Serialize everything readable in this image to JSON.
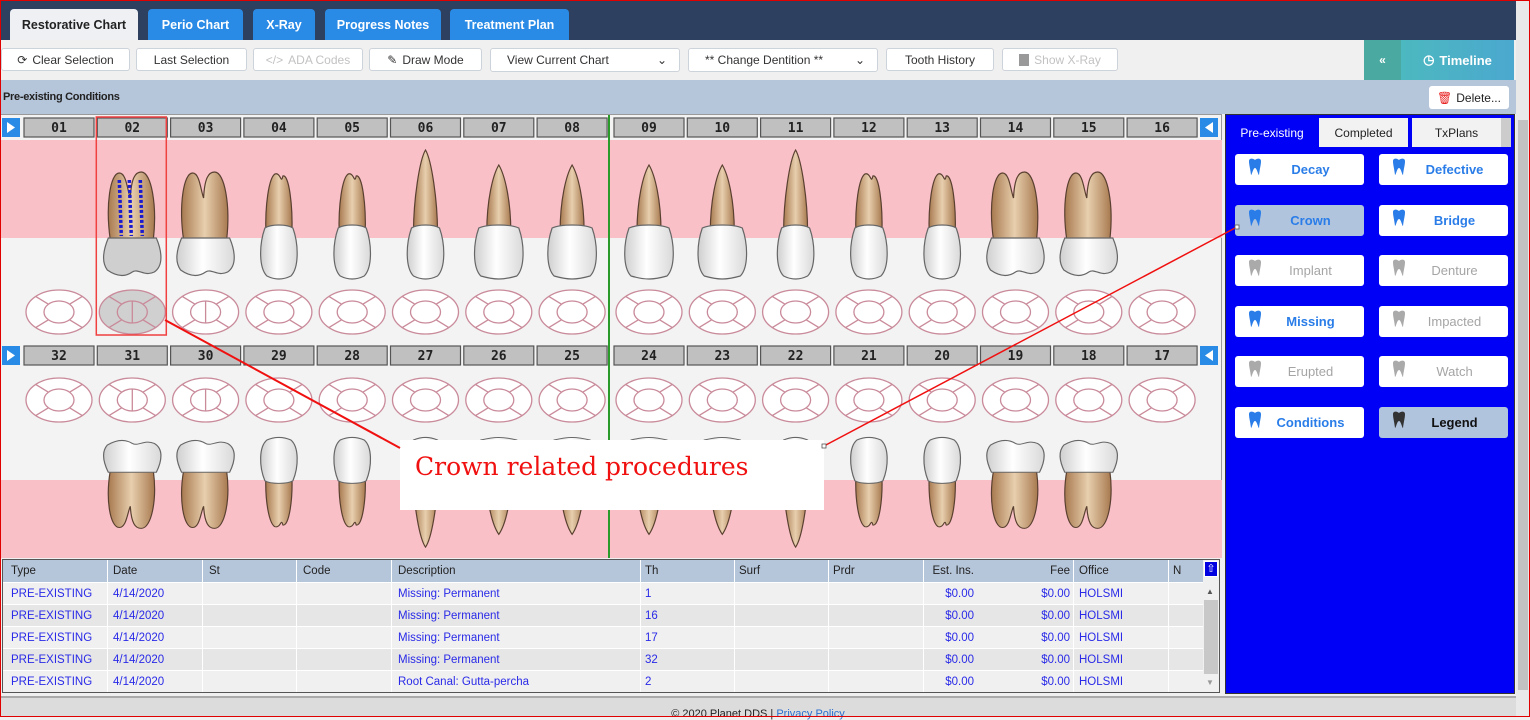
{
  "tabs": [
    {
      "label": "Restorative Chart",
      "active": true
    },
    {
      "label": "Perio Chart"
    },
    {
      "label": "X-Ray"
    },
    {
      "label": "Progress Notes"
    },
    {
      "label": "Treatment Plan"
    }
  ],
  "toolbar": {
    "clear_selection": "Clear Selection",
    "last_selection": "Last Selection",
    "ada_codes": "ADA Codes",
    "draw_mode": "Draw Mode",
    "view_select": "View Current Chart",
    "dentition_select": "** Change Dentition **",
    "tooth_history": "Tooth History",
    "show_xray": "Show X-Ray",
    "timeline": "Timeline"
  },
  "condition_bar": {
    "title": "Pre-existing Conditions",
    "delete": "Delete..."
  },
  "chart": {
    "upper_teeth": [
      "01",
      "02",
      "03",
      "04",
      "05",
      "06",
      "07",
      "08",
      "09",
      "10",
      "11",
      "12",
      "13",
      "14",
      "15",
      "16"
    ],
    "lower_teeth": [
      "32",
      "31",
      "30",
      "29",
      "28",
      "27",
      "26",
      "25",
      "24",
      "23",
      "22",
      "21",
      "20",
      "19",
      "18",
      "17"
    ],
    "missing": [
      1,
      16,
      17,
      32
    ],
    "root_canal": [
      2
    ],
    "selected_tooth": 2,
    "colors": {
      "gum": "#f9c0c8",
      "root": "#c49a6c",
      "occlusal": "#c98a9a",
      "selection": "#f04040",
      "midline": "#2a9a2a"
    }
  },
  "annotation": {
    "text": "Crown related procedures",
    "color": "#f01010"
  },
  "panel": {
    "tabs": [
      {
        "label": "Pre-existing",
        "active": true
      },
      {
        "label": "Completed"
      },
      {
        "label": "TxPlans"
      }
    ],
    "buttons": [
      {
        "label": "Decay",
        "icon": "tooth-icon",
        "state": "enabled"
      },
      {
        "label": "Defective",
        "icon": "tooth-icon",
        "state": "enabled"
      },
      {
        "label": "Crown",
        "icon": "crown-tooth-icon",
        "state": "selected"
      },
      {
        "label": "Bridge",
        "icon": "bridge-icon",
        "state": "enabled"
      },
      {
        "label": "Implant",
        "icon": "implant-icon",
        "state": "disabled"
      },
      {
        "label": "Denture",
        "icon": "denture-icon",
        "state": "disabled"
      },
      {
        "label": "Missing",
        "icon": "missing-tooth-icon",
        "state": "enabled"
      },
      {
        "label": "Impacted",
        "icon": "impacted-tooth-icon",
        "state": "disabled"
      },
      {
        "label": "Erupted",
        "icon": "erupted-tooth-icon",
        "state": "disabled"
      },
      {
        "label": "Watch",
        "icon": "watch-tooth-icon",
        "state": "disabled"
      },
      {
        "label": "Conditions",
        "icon": "conditions-icon",
        "state": "enabled"
      },
      {
        "label": "Legend",
        "icon": "legend-tooth-icon",
        "state": "selected"
      }
    ]
  },
  "table": {
    "columns": [
      "Type",
      "Date",
      "St",
      "Code",
      "Description",
      "Th",
      "Surf",
      "Prdr",
      "Est. Ins.",
      "Fee",
      "Office",
      "N"
    ],
    "rows": [
      [
        "PRE-EXISTING",
        "4/14/2020",
        "",
        "",
        "Missing: Permanent",
        "1",
        "",
        "",
        "$0.00",
        "$0.00",
        "HOLSMI",
        ""
      ],
      [
        "PRE-EXISTING",
        "4/14/2020",
        "",
        "",
        "Missing: Permanent",
        "16",
        "",
        "",
        "$0.00",
        "$0.00",
        "HOLSMI",
        ""
      ],
      [
        "PRE-EXISTING",
        "4/14/2020",
        "",
        "",
        "Missing: Permanent",
        "17",
        "",
        "",
        "$0.00",
        "$0.00",
        "HOLSMI",
        ""
      ],
      [
        "PRE-EXISTING",
        "4/14/2020",
        "",
        "",
        "Missing: Permanent",
        "32",
        "",
        "",
        "$0.00",
        "$0.00",
        "HOLSMI",
        ""
      ],
      [
        "PRE-EXISTING",
        "4/14/2020",
        "",
        "",
        "Root Canal:  Gutta-percha",
        "2",
        "",
        "",
        "$0.00",
        "$0.00",
        "HOLSMI",
        ""
      ]
    ]
  },
  "footer": {
    "copyright": "© 2020 Planet DDS | ",
    "privacy": "Privacy Policy"
  }
}
